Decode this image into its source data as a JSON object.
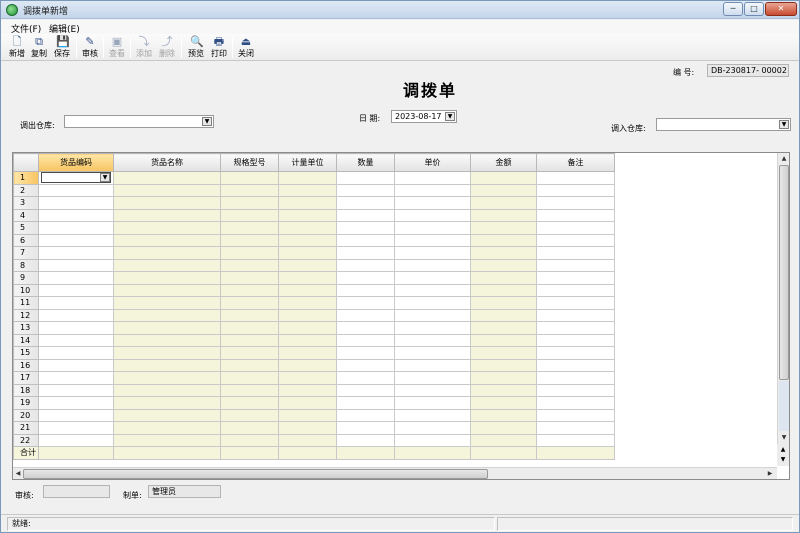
{
  "window": {
    "title": "调拨单新增",
    "min_label": "─",
    "max_label": "□",
    "close_label": "✕"
  },
  "menu": [
    {
      "label": "文件(F)"
    },
    {
      "label": "编辑(E)"
    }
  ],
  "toolbar": [
    {
      "label": "新增",
      "icon": "new-doc-icon",
      "glyph": "🗋",
      "disabled": false
    },
    {
      "label": "复制",
      "icon": "copy-icon",
      "glyph": "⧉",
      "disabled": false
    },
    {
      "label": "保存",
      "icon": "save-icon",
      "glyph": "💾",
      "disabled": false
    },
    {
      "label": "审核",
      "icon": "approve-icon",
      "glyph": "✎",
      "disabled": false
    },
    {
      "label": "查看",
      "icon": "view-icon",
      "glyph": "▣",
      "disabled": true
    },
    {
      "label": "添加",
      "icon": "add-row-icon",
      "glyph": "⤵",
      "disabled": true
    },
    {
      "label": "删除",
      "icon": "delete-row-icon",
      "glyph": "⤴",
      "disabled": true
    },
    {
      "label": "预览",
      "icon": "preview-icon",
      "glyph": "🔍",
      "disabled": false
    },
    {
      "label": "打印",
      "icon": "print-icon",
      "glyph": "🖶",
      "disabled": false
    },
    {
      "label": "关闭",
      "icon": "close-doc-icon",
      "glyph": "⏏",
      "disabled": false
    }
  ],
  "header": {
    "doc_title": "调拨单",
    "number_label": "编  号:",
    "number_value": "DB-230817- 00002",
    "out_wh_label": "调出仓库:",
    "out_wh_value": "",
    "date_label": "日  期:",
    "date_value": "2023-08-17",
    "in_wh_label": "调入仓库:",
    "in_wh_value": ""
  },
  "grid": {
    "columns": [
      "货品编码",
      "货品名称",
      "规格型号",
      "计量单位",
      "数量",
      "单价",
      "金额",
      "备注"
    ],
    "row_numbers": [
      "1",
      "2",
      "3",
      "4",
      "5",
      "6",
      "7",
      "8",
      "9",
      "10",
      "11",
      "12",
      "13",
      "14",
      "15",
      "16",
      "17",
      "18",
      "19",
      "20",
      "21",
      "22"
    ],
    "total_label": "合计"
  },
  "footer": {
    "reviewer_label": "审核:",
    "reviewer_value": "",
    "maker_label": "制单:",
    "maker_value": "管理员"
  },
  "status": {
    "text": "就绪:"
  }
}
